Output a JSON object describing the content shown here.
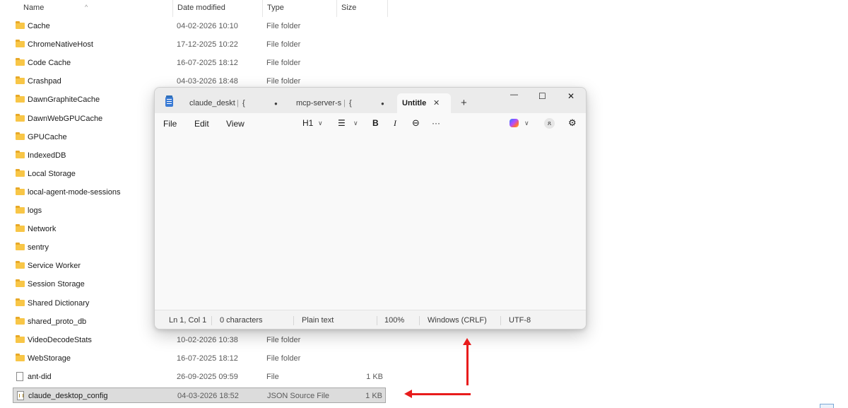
{
  "explorer": {
    "columns": {
      "name": "Name",
      "date": "Date modified",
      "type": "Type",
      "size": "Size"
    },
    "rows": [
      {
        "name": "Cache",
        "date": "04-02-2026 10:10",
        "type": "File folder",
        "size": ""
      },
      {
        "name": "ChromeNativeHost",
        "date": "17-12-2025 10:22",
        "type": "File folder",
        "size": ""
      },
      {
        "name": "Code Cache",
        "date": "16-07-2025 18:12",
        "type": "File folder",
        "size": ""
      },
      {
        "name": "Crashpad",
        "date": "04-03-2026 18:48",
        "type": "File folder",
        "size": ""
      },
      {
        "name": "DawnGraphiteCache",
        "date": "",
        "type": "",
        "size": ""
      },
      {
        "name": "DawnWebGPUCache",
        "date": "",
        "type": "",
        "size": ""
      },
      {
        "name": "GPUCache",
        "date": "",
        "type": "",
        "size": ""
      },
      {
        "name": "IndexedDB",
        "date": "",
        "type": "",
        "size": ""
      },
      {
        "name": "Local Storage",
        "date": "",
        "type": "",
        "size": ""
      },
      {
        "name": "local-agent-mode-sessions",
        "date": "",
        "type": "",
        "size": ""
      },
      {
        "name": "logs",
        "date": "",
        "type": "",
        "size": ""
      },
      {
        "name": "Network",
        "date": "",
        "type": "",
        "size": ""
      },
      {
        "name": "sentry",
        "date": "",
        "type": "",
        "size": ""
      },
      {
        "name": "Service Worker",
        "date": "",
        "type": "",
        "size": ""
      },
      {
        "name": "Session Storage",
        "date": "",
        "type": "",
        "size": ""
      },
      {
        "name": "Shared Dictionary",
        "date": "",
        "type": "",
        "size": ""
      },
      {
        "name": "shared_proto_db",
        "date": "",
        "type": "",
        "size": ""
      },
      {
        "name": "VideoDecodeStats",
        "date": "10-02-2026 10:38",
        "type": "File folder",
        "size": ""
      },
      {
        "name": "WebStorage",
        "date": "16-07-2025 18:12",
        "type": "File folder",
        "size": ""
      },
      {
        "name": "ant-did",
        "date": "26-09-2025 09:59",
        "type": "File",
        "size": "1 KB"
      },
      {
        "name": "claude_desktop_config",
        "date": "04-03-2026 18:52",
        "type": "JSON Source File",
        "size": "1 KB"
      }
    ]
  },
  "notepad": {
    "tabs": [
      {
        "label": "claude_deskt",
        "extra": "{",
        "dot": "●"
      },
      {
        "label": "mcp-server-s",
        "extra": "{",
        "dot": "●"
      },
      {
        "label": "Untitle",
        "close": "✕"
      }
    ],
    "new_tab": "+",
    "window_controls": {
      "minimize": "—",
      "maximize": "☐",
      "close": "✕"
    },
    "menu": {
      "file": "File",
      "edit": "Edit",
      "view": "View"
    },
    "toolbar": {
      "heading": "H1",
      "heading_chevron": "∨",
      "list": "☰",
      "list_chevron": "∨",
      "bold": "B",
      "italic": "I",
      "link": "⊖",
      "more": "···",
      "copilot_chevron": "∨",
      "profile": "ጸ",
      "settings": "⚙"
    },
    "status": {
      "position": "Ln 1, Col 1",
      "chars": "0 characters",
      "format": "Plain text",
      "zoom": "100%",
      "line_ending": "Windows (CRLF)",
      "encoding": "UTF-8"
    }
  },
  "colors": {
    "annotation_arrow": "#e81c1c",
    "folder": "#f8c647",
    "notepad_icon": "#3a7bd5"
  }
}
